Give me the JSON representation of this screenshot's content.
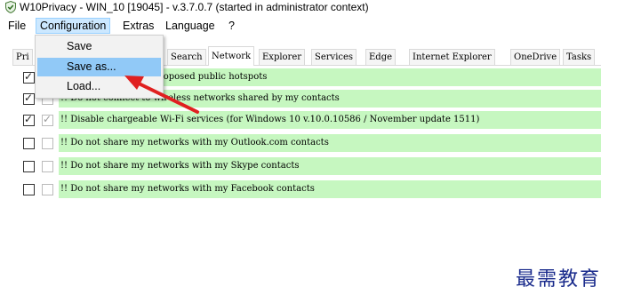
{
  "window": {
    "title": "W10Privacy - WIN_10 [19045]  - v.3.7.0.7 (started in administrator context)",
    "icon": "shield-check-icon"
  },
  "menubar": {
    "items": [
      "File",
      "Configuration",
      "Extras",
      "Language",
      "?"
    ],
    "active": "Configuration"
  },
  "dropdown": {
    "items": [
      "Save",
      "Save as...",
      "Load..."
    ],
    "highlighted": "Save as..."
  },
  "tabs": {
    "items": [
      "Pri",
      "Search",
      "Network",
      "Explorer",
      "Services",
      "Edge",
      "Internet Explorer",
      "OneDrive",
      "Tasks"
    ],
    "selected": "Network"
  },
  "rows": [
    {
      "text": "!! Do not connect to proposed public hotspots",
      "checked": true,
      "checked2": false
    },
    {
      "text": "!! Do not connect to wireless networks shared by my contacts",
      "checked": true,
      "checked2": false
    },
    {
      "text": "!! Disable chargeable Wi-Fi services (for Windows 10 v.10.0.10586 / November update 1511)",
      "checked": true,
      "checked2": true
    },
    {
      "text": "!! Do not share my networks with my Outlook.com contacts",
      "checked": false,
      "checked2": false
    },
    {
      "text": "!! Do not share my networks with my Skype contacts",
      "checked": false,
      "checked2": false
    },
    {
      "text": "!! Do not share my networks with my Facebook contacts",
      "checked": false,
      "checked2": false
    }
  ],
  "colors": {
    "row_highlight": "#c6f7c0",
    "menu_active": "#cce8ff",
    "dropdown_hover": "#91c9f7",
    "annotation_arrow": "#e02020",
    "watermark": "#1a2b8c"
  },
  "watermark": "最需教育"
}
